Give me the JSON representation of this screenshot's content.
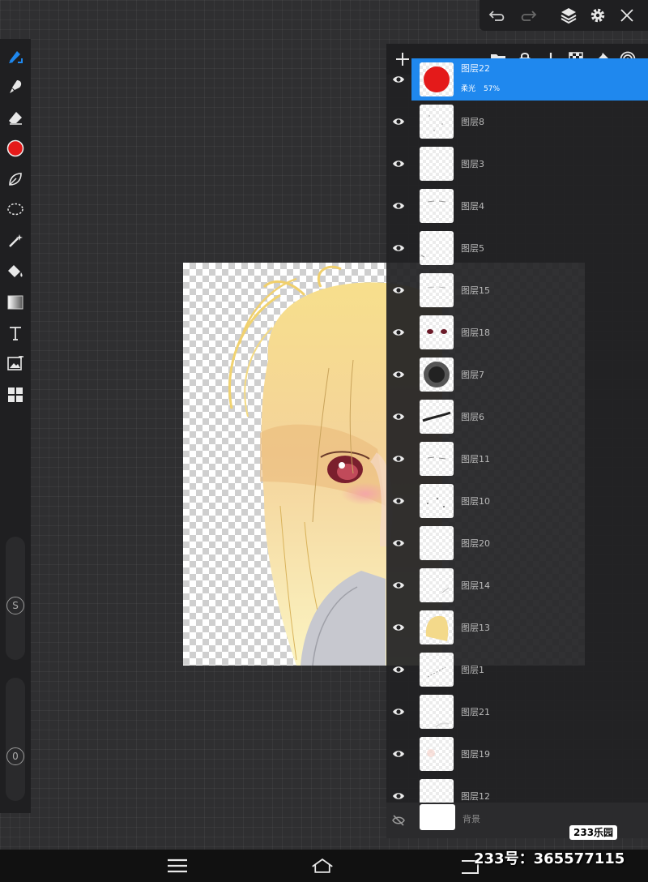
{
  "toolbar": {
    "tools": [
      {
        "name": "brush-tool",
        "icon": "brush-pen-icon",
        "active": true
      },
      {
        "name": "smudge-tool",
        "icon": "smudge-icon"
      },
      {
        "name": "eraser-tool",
        "icon": "eraser-icon"
      },
      {
        "name": "color-picker",
        "icon": "color-swatch-icon",
        "color": "#e41a1a"
      },
      {
        "name": "leaf-tool",
        "icon": "leaf-icon"
      },
      {
        "name": "lasso-tool",
        "icon": "lasso-icon"
      },
      {
        "name": "magic-wand-tool",
        "icon": "magic-wand-icon"
      },
      {
        "name": "fill-tool",
        "icon": "paint-bucket-icon"
      },
      {
        "name": "gradient-tool",
        "icon": "gradient-icon"
      },
      {
        "name": "text-tool",
        "icon": "text-icon"
      },
      {
        "name": "image-tool",
        "icon": "image-icon"
      },
      {
        "name": "panels-tool",
        "icon": "grid-panels-icon"
      }
    ],
    "size_slider_label": "S",
    "opacity_slider_label": "0"
  },
  "top_bar": {
    "buttons": [
      "undo-icon",
      "redo-icon",
      "layers-icon",
      "gear-icon",
      "close-icon"
    ]
  },
  "layers_panel": {
    "toolbar_icons": [
      "add-layer-icon",
      "folder-icon",
      "lock-icon",
      "merge-down-icon",
      "transparency-icon",
      "pin-icon",
      "target-icon"
    ],
    "selected_layer": {
      "name": "图层22",
      "mode": "柔光",
      "opacity": "57%"
    },
    "layers": [
      "图层8",
      "图层3",
      "图层4",
      "图层5",
      "图层15",
      "图层18",
      "图层7",
      "图层6",
      "图层11",
      "图层10",
      "图层20",
      "图层14",
      "图层13",
      "图层1",
      "图层21",
      "图层19",
      "图层12"
    ],
    "background_layer": "背景"
  },
  "watermark": {
    "badge": "233乐园",
    "text": "233号：365577115"
  },
  "nav_bar": {
    "buttons": [
      "menu-icon",
      "home-icon",
      "back-icon"
    ]
  },
  "colors": {
    "accent": "#1f88ee",
    "panel": "#1f1f21",
    "brush_color": "#e41a1a"
  }
}
